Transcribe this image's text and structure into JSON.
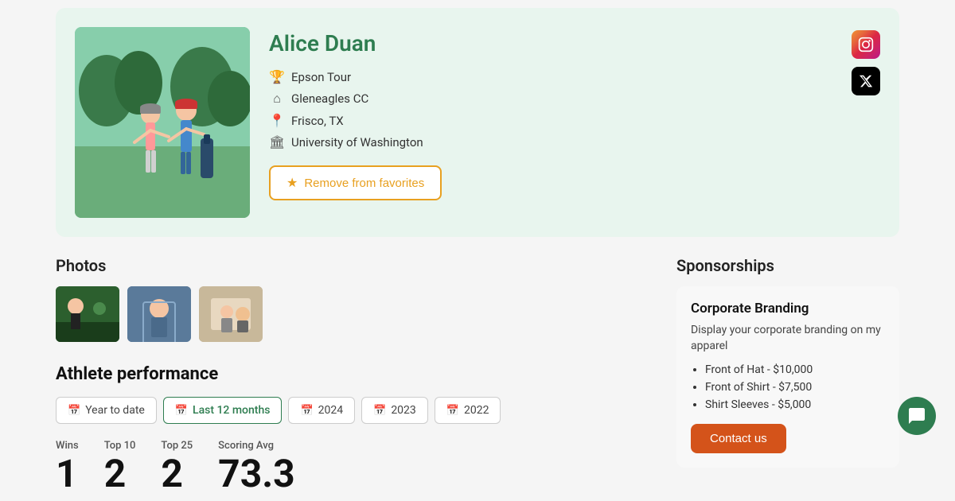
{
  "profile": {
    "name": "Alice Duan",
    "tour": "Epson Tour",
    "club": "Gleneagles CC",
    "location": "Frisco, TX",
    "university": "University of Washington",
    "remove_favorites_label": "Remove from favorites",
    "instagram_label": "Instagram",
    "twitter_label": "X (Twitter)"
  },
  "photos": {
    "section_title": "Photos",
    "items": [
      {
        "alt": "Photo 1"
      },
      {
        "alt": "Photo 2"
      },
      {
        "alt": "Photo 3"
      }
    ]
  },
  "performance": {
    "title": "Athlete performance",
    "tabs": [
      {
        "label": "Year to date",
        "active": false
      },
      {
        "label": "Last 12 months",
        "active": true
      },
      {
        "label": "2024",
        "active": false
      },
      {
        "label": "2023",
        "active": false
      },
      {
        "label": "2022",
        "active": false
      }
    ],
    "stats": [
      {
        "label": "Wins",
        "value": "1"
      },
      {
        "label": "Top 10",
        "value": "2"
      },
      {
        "label": "Top 25",
        "value": "2"
      },
      {
        "label": "Scoring Avg",
        "value": "73.3"
      }
    ]
  },
  "sponsorships": {
    "title": "Sponsorships",
    "card_title": "Corporate Branding",
    "description": "Display your corporate branding on my apparel",
    "items": [
      "Front of Hat - $10,000",
      "Front of Shirt - $7,500",
      "Shirt Sleeves - $5,000"
    ],
    "contact_button_label": "Contact us"
  },
  "chat": {
    "label": "Chat"
  }
}
